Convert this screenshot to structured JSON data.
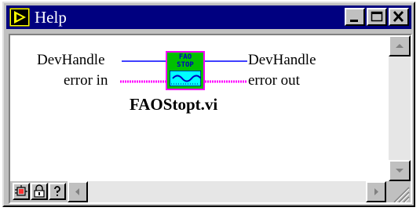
{
  "window": {
    "title": "Help",
    "controls": {
      "minimize": "minimize",
      "maximize": "maximize",
      "close": "close"
    }
  },
  "connector": {
    "vi_name": "FAOStopt.vi",
    "icon_text_line1": "FAO",
    "icon_text_line2": "STOP",
    "inputs": [
      {
        "label": "DevHandle",
        "wire": "blue"
      },
      {
        "label": "error in",
        "wire": "pink"
      }
    ],
    "outputs": [
      {
        "label": "DevHandle",
        "wire": "blue"
      },
      {
        "label": "error out",
        "wire": "pink"
      }
    ]
  },
  "footer_buttons": [
    {
      "name": "simple-diagram-help-button",
      "icon": "diagram-icon"
    },
    {
      "name": "lock-button",
      "icon": "lock-icon"
    },
    {
      "name": "help-button",
      "icon": "question-icon"
    }
  ],
  "colors": {
    "titlebar": "#000080",
    "wire_blue": "#0000ff",
    "wire_pink": "#ff00ff",
    "icon_bg": "#00c000",
    "icon_border": "#ff00ff",
    "icon_screen": "#00ffff"
  }
}
